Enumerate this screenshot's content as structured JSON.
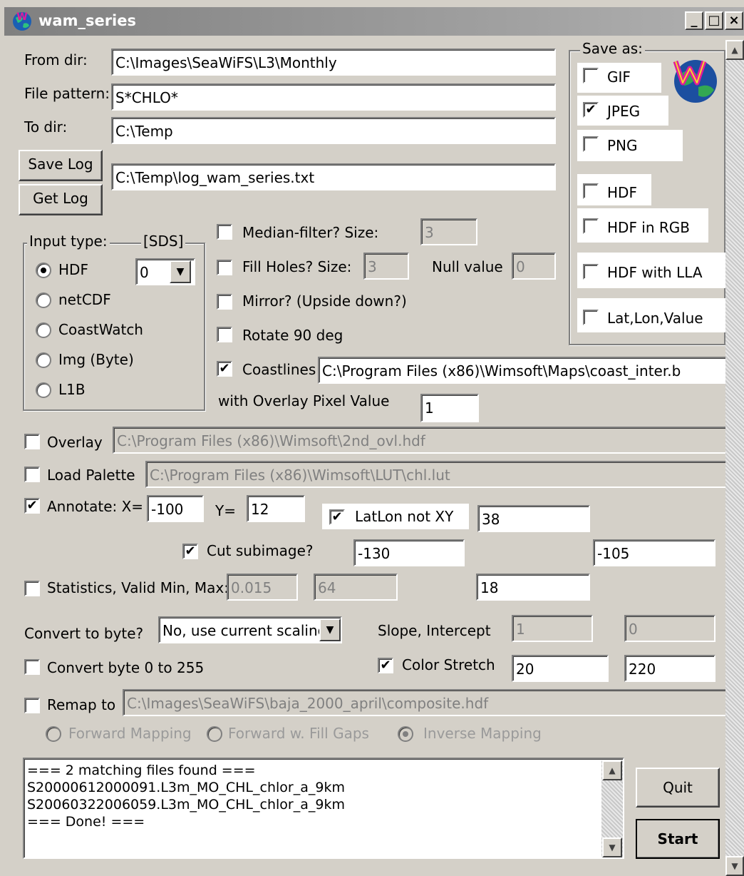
{
  "window": {
    "title": "wam_series",
    "minimize": "_",
    "maximize": "□",
    "close": "×"
  },
  "paths": {
    "from_dir_label": "From dir:",
    "from_dir": "C:\\Images\\SeaWiFS\\L3\\Monthly",
    "file_pattern_label": "File pattern:",
    "file_pattern": "S*CHLO*",
    "to_dir_label": "To dir:",
    "to_dir": "C:\\Temp",
    "save_log_label": "Save Log",
    "get_log_label": "Get Log",
    "log_file": "C:\\Temp\\log_wam_series.txt"
  },
  "save_as": {
    "legend": "Save as:",
    "gif": "GIF",
    "jpeg": "JPEG",
    "png": "PNG",
    "hdf": "HDF",
    "hdf_rgb": "HDF in RGB",
    "hdf_lla": "HDF with LLA",
    "latlon": "Lat,Lon,Value"
  },
  "input_type": {
    "legend": "Input type:",
    "sds_label": "[SDS]",
    "sds_value": "0",
    "options": [
      "HDF",
      "netCDF",
      "CoastWatch",
      "Img (Byte)",
      "L1B"
    ],
    "selected": "HDF"
  },
  "filters": {
    "median_label": "Median-filter? Size:",
    "median_size": "3",
    "fill_label": "Fill Holes? Size:",
    "fill_size": "3",
    "null_label": "Null value",
    "null_value": "0",
    "mirror_label": "Mirror? (Upside down?)",
    "rotate_label": "Rotate 90 deg",
    "coast_label": "Coastlines",
    "coast_path": "C:\\Program Files (x86)\\Wimsoft\\Maps\\coast_inter.b",
    "overlay_pixel_label": "with Overlay Pixel Value",
    "overlay_pixel_value": "1"
  },
  "overlay": {
    "label": "Overlay",
    "path": "C:\\Program Files (x86)\\Wimsoft\\2nd_ovl.hdf"
  },
  "palette": {
    "label": "Load Palette",
    "path": "C:\\Program Files (x86)\\Wimsoft\\LUT\\chl.lut"
  },
  "annotate": {
    "label": "Annotate: X=",
    "x": "-100",
    "y_label": "Y=",
    "y": "12",
    "latlon_label": "LatLon not XY",
    "v1": "38"
  },
  "cut": {
    "label": "Cut subimage?",
    "v1": "-130",
    "v2": "-105"
  },
  "stats": {
    "label": "Statistics, Valid Min, Max:",
    "min": "0.015",
    "max": "64",
    "v3": "18"
  },
  "convert": {
    "label": "Convert to byte?",
    "selected": "No, use current scaling",
    "slope_label": "Slope, Intercept",
    "slope": "1",
    "intercept": "0",
    "byte_label": "Convert byte 0 to 255",
    "stretch_label": "Color Stretch",
    "stretch_min": "20",
    "stretch_max": "220"
  },
  "remap": {
    "label": "Remap to",
    "path": "C:\\Images\\SeaWiFS\\baja_2000_april\\composite.hdf",
    "forward": "Forward Mapping",
    "forward_fill": "Forward w. Fill Gaps",
    "inverse": "Inverse Mapping"
  },
  "log": {
    "lines": [
      "=== 2 matching files found  ===",
      "S20000612000091.L3m_MO_CHL_chlor_a_9km",
      "S20060322006059.L3m_MO_CHL_chlor_a_9km",
      "=== Done! ==="
    ]
  },
  "actions": {
    "quit": "Quit",
    "start": "Start"
  },
  "checked_mark": "✔"
}
